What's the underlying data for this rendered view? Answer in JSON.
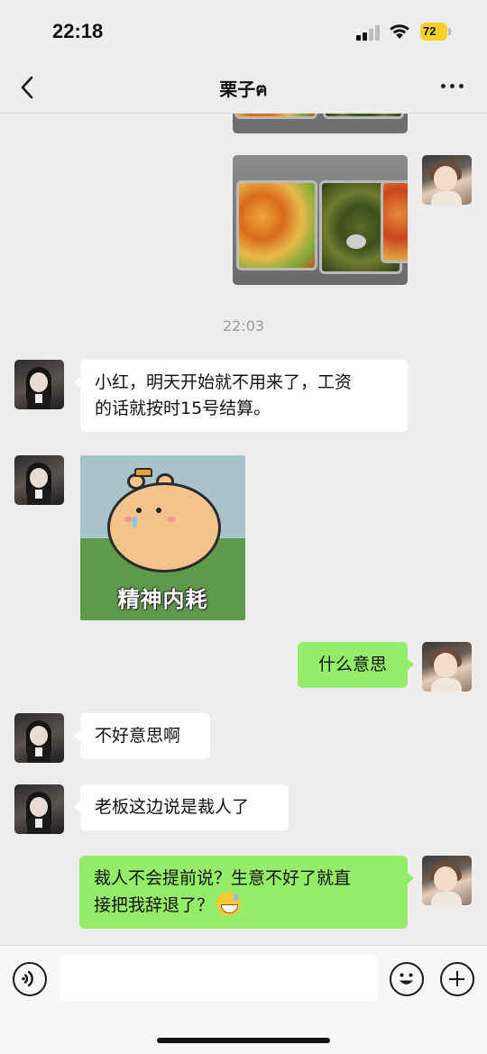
{
  "status_bar": {
    "time": "22:18",
    "battery": "72"
  },
  "nav": {
    "title": "栗子ฅ"
  },
  "messages": {
    "timestamp": "22:03",
    "m1": "小红，明天开始就不用来了，工资的话就按时15号结算。",
    "m1_line1": "小红，明天开始就不用来了，工资",
    "m1_line2": "的话就按时15号结算。",
    "sticker_caption": "精神内耗",
    "m2": "什么意思",
    "m3": "不好意思啊",
    "m4": "老板这边说是裁人了",
    "m5_line1": "裁人不会提前说？生意不好了就直",
    "m5_line2": "接把我辞退了？"
  },
  "icons": {
    "back": "chevron-left-icon",
    "more": "more-dots-icon",
    "voice": "voice-icon",
    "emoji": "emoji-icon",
    "plus": "plus-icon",
    "reply_emoji": "sweat-smile-emoji"
  },
  "colors": {
    "background": "#ededed",
    "my_bubble": "#95ec69",
    "their_bubble": "#ffffff",
    "battery": "#f7d02c"
  }
}
